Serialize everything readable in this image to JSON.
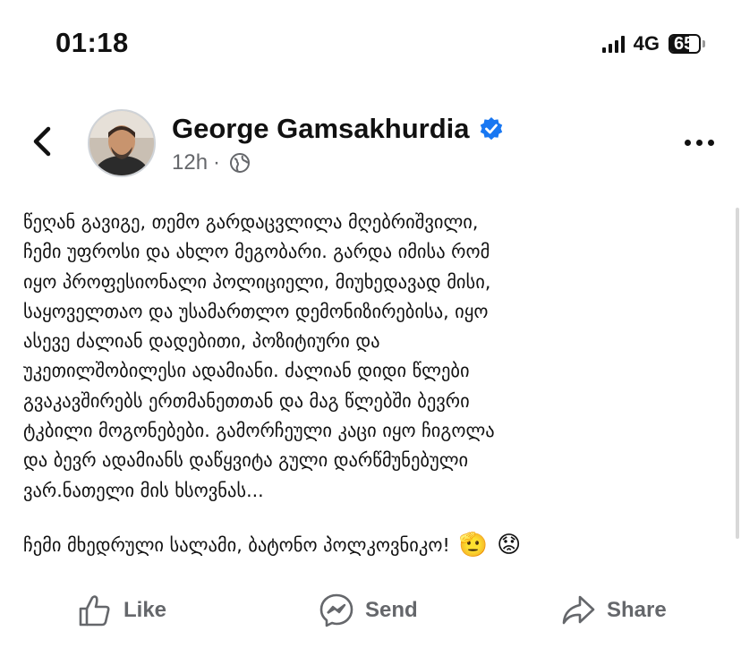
{
  "status_bar": {
    "time": "01:18",
    "network": "4G",
    "battery_percent": "65",
    "battery_level": 0.65
  },
  "post": {
    "author": "George Gamsakhurdia",
    "verified": true,
    "timestamp": "12h",
    "separator": "·",
    "audience_icon": "globe-icon",
    "body": "წეღან გავიგე, თემო გარდაცვლილა მღებრიშვილი,\nჩემი უფროსი და ახლო მეგობარი. გარდა იმისა რომ\nიყო პროფესიონალი პოლიციელი, მიუხედავად მისი,\nსაყოველთაო და უსამართლო დემონიზირებისა, იყო\nასევე ძალიან დადებითი, პოზიტიური და\nუკეთილშობილესი ადამიანი. ძალიან დიდი წლები\nგვაკავშირებს ერთმანეთთან და მაგ წლებში ბევრი\nტკბილი მოგონებები. გამორჩეული კაცი იყო ჩიგოლა\nდა ბევრ ადამიანს დაწყვიტა გული დარწმუნებული\nვარ.ნათელი მის ხსოვნას...",
    "closing": "ჩემი მხედრული სალამი, ბატონო პოლკოვნიკო!",
    "emojis": [
      "🫡",
      "😟"
    ]
  },
  "actions": {
    "like": "Like",
    "send": "Send",
    "share": "Share"
  },
  "colors": {
    "text": "#111111",
    "secondary_text": "#65676b",
    "verified_blue": "#1877f2"
  }
}
